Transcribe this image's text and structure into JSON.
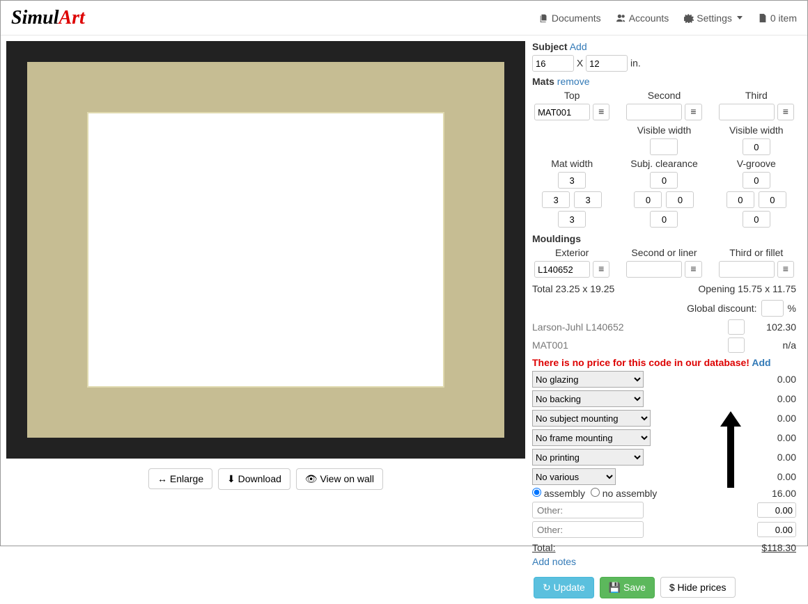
{
  "nav": {
    "documents": "Documents",
    "accounts": "Accounts",
    "settings": "Settings",
    "cart": "0 item"
  },
  "preview": {
    "enlarge": "Enlarge",
    "download": "Download",
    "viewwall": "View on wall"
  },
  "subject": {
    "label": "Subject",
    "add": "Add",
    "width": "16",
    "height": "12",
    "x": "X",
    "unit": "in."
  },
  "mats": {
    "label": "Mats",
    "remove": "remove",
    "top": "Top",
    "second": "Second",
    "third": "Third",
    "top_code": "MAT001",
    "visible_width": "Visible width",
    "vw_third": "0",
    "mat_width": "Mat width",
    "subj_clearance": "Subj. clearance",
    "vgroove": "V-groove",
    "mw_top": "3",
    "mw_l": "3",
    "mw_r": "3",
    "mw_b": "3",
    "sc_t": "0",
    "sc_l": "0",
    "sc_r": "0",
    "sc_b": "0",
    "vg_t": "0",
    "vg_l": "0",
    "vg_r": "0",
    "vg_b": "0"
  },
  "mouldings": {
    "label": "Mouldings",
    "exterior": "Exterior",
    "second": "Second or liner",
    "third": "Third or fillet",
    "ext_code": "L140652"
  },
  "sizes": {
    "total": "Total 23.25 x 19.25",
    "opening": "Opening 15.75 x 11.75"
  },
  "discount": {
    "label": "Global discount:",
    "pct": "%"
  },
  "lines": {
    "moulding_name": "Larson-Juhl L140652",
    "moulding_price": "102.30",
    "mat_name": "MAT001",
    "mat_price": "n/a",
    "warning": "There is no price for this code in our database!",
    "add": "Add",
    "glazing": "No glazing",
    "glazing_p": "0.00",
    "backing": "No backing",
    "backing_p": "0.00",
    "smount": "No subject mounting",
    "smount_p": "0.00",
    "fmount": "No frame mounting",
    "fmount_p": "0.00",
    "printing": "No printing",
    "printing_p": "0.00",
    "various": "No various",
    "various_p": "0.00",
    "assembly": "assembly",
    "noassembly": "no assembly",
    "assembly_p": "16.00",
    "other": "Other:",
    "other1_p": "0.00",
    "other2_p": "0.00",
    "total_lbl": "Total:",
    "total": "$118.30",
    "notes": "Add notes"
  },
  "actions": {
    "update": "Update",
    "save": "Save",
    "hide": "Hide prices"
  }
}
